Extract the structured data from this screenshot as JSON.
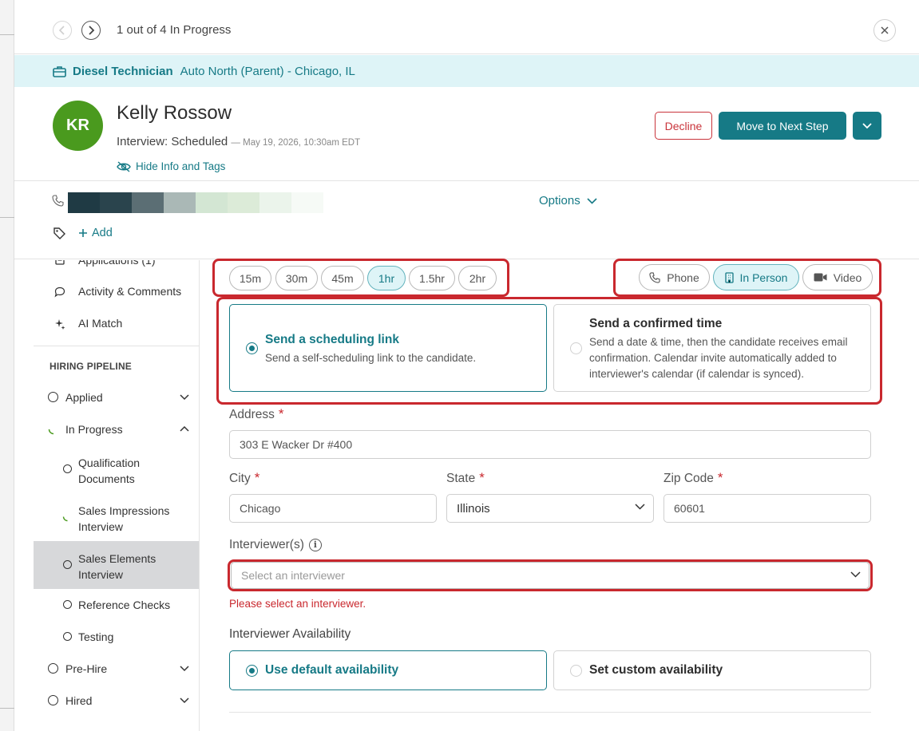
{
  "topbar": {
    "counter": "1 out of 4 In Progress"
  },
  "job": {
    "title": "Diesel Technician",
    "company": "Auto North (Parent) - Chicago, IL"
  },
  "candidate": {
    "initials": "KR",
    "name": "Kelly Rossow",
    "status": "Interview: Scheduled",
    "date": "— May 19, 2026, 10:30am EDT",
    "hide_info": "Hide Info and Tags"
  },
  "actions": {
    "decline": "Decline",
    "next_step": "Move to Next Step"
  },
  "contact": {
    "redacted_colors": [
      "#1f3a44",
      "#2a444d",
      "#5b6e74",
      "#aab8b6",
      "#d3e6d3",
      "#dcebd8",
      "#ebf4eb",
      "#f6faf6"
    ],
    "options": "Options",
    "add_tag": "Add"
  },
  "sidebar": {
    "top_items": [
      {
        "label": "Applications (1)",
        "icon": "document-icon"
      },
      {
        "label": "Activity & Comments",
        "icon": "comment-icon"
      },
      {
        "label": "AI Match",
        "icon": "sparkle-icon"
      }
    ],
    "section_title": "HIRING PIPELINE",
    "stages": [
      {
        "label": "Applied"
      },
      {
        "label": "In Progress"
      },
      {
        "label": "Qualification Documents"
      },
      {
        "label": "Sales Impressions Interview"
      },
      {
        "label": "Sales Elements Interview"
      },
      {
        "label": "Reference Checks"
      },
      {
        "label": "Testing"
      },
      {
        "label": "Pre-Hire"
      },
      {
        "label": "Hired"
      }
    ]
  },
  "durations": {
    "options": [
      "15m",
      "30m",
      "45m",
      "1hr",
      "1.5hr",
      "2hr"
    ],
    "selected": "1hr"
  },
  "modes": {
    "options": [
      "Phone",
      "In Person",
      "Video"
    ],
    "selected": "In Person"
  },
  "schedule_options": {
    "link": {
      "title": "Send a scheduling link",
      "desc": "Send a self-scheduling link to the candidate."
    },
    "confirmed": {
      "title": "Send a confirmed time",
      "desc": "Send a date & time, then the candidate receives email confirmation. Calendar invite automatically added to interviewer's calendar (if calendar is synced)."
    }
  },
  "form": {
    "address_label": "Address",
    "address_value": "303 E Wacker Dr #400",
    "city_label": "City",
    "city_value": "Chicago",
    "state_label": "State",
    "state_value": "Illinois",
    "zip_label": "Zip Code",
    "zip_value": "60601",
    "required_mark": "*",
    "interviewers_label": "Interviewer(s)",
    "interviewer_placeholder": "Select an interviewer",
    "interviewer_error": "Please select an interviewer.",
    "availability_label": "Interviewer Availability",
    "availability_default": "Use default availability",
    "availability_custom": "Set custom availability"
  },
  "colors": {
    "accent": "#167a86",
    "error": "#c9282e",
    "avatar": "#4a9a1e",
    "banner": "#def4f7"
  }
}
